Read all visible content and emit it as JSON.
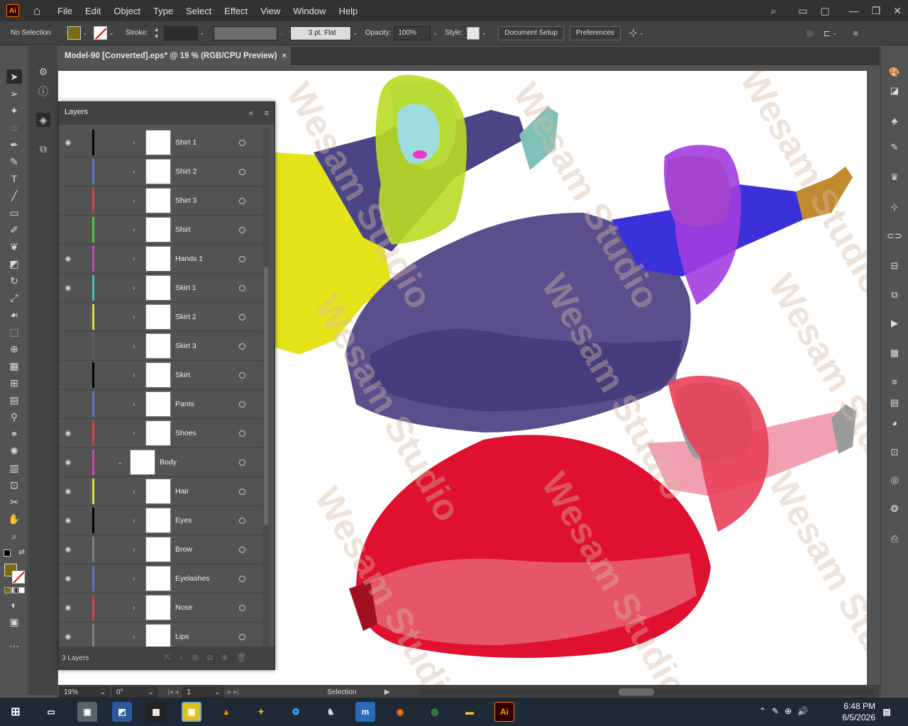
{
  "app": {
    "logo": "Ai",
    "menus": [
      "File",
      "Edit",
      "Object",
      "Type",
      "Select",
      "Effect",
      "View",
      "Window",
      "Help"
    ]
  },
  "control": {
    "selection": "No Selection",
    "stroke_label": "Stroke:",
    "brush": "3 pt. Flat",
    "opacity_label": "Opacity:",
    "opacity": "100%",
    "style_label": "Style:",
    "document_setup": "Document Setup",
    "preferences": "Preferences",
    "fill_color": "#7a6a10"
  },
  "document": {
    "tab_title": "Model-90 [Converted].eps* @ 19 % (RGB/CPU Preview)",
    "close": "×"
  },
  "layers": {
    "title": "Layers",
    "footer": "3 Layers",
    "rows": [
      {
        "name": "Shirt 1",
        "color": "#000000",
        "visible": true
      },
      {
        "name": "Shirt 2",
        "color": "#5a6fd0",
        "visible": false
      },
      {
        "name": "Shirt 3",
        "color": "#d04040",
        "visible": false
      },
      {
        "name": "Shirt",
        "color": "#40d040",
        "visible": false
      },
      {
        "name": "Hands 1",
        "color": "#d040c0",
        "visible": true
      },
      {
        "name": "Skirt 1",
        "color": "#40c0c0",
        "visible": true
      },
      {
        "name": "Skirt 2",
        "color": "#e0e040",
        "visible": false
      },
      {
        "name": "Skirt 3",
        "color": "#606060",
        "visible": false
      },
      {
        "name": "Skirt",
        "color": "#000000",
        "visible": false
      },
      {
        "name": "Pants",
        "color": "#5a6fd0",
        "visible": false
      },
      {
        "name": "Shoes",
        "color": "#d04040",
        "visible": true
      },
      {
        "name": "Body",
        "color": "#d040c0",
        "visible": true
      },
      {
        "name": "Hair",
        "color": "#e0e040",
        "visible": true
      },
      {
        "name": "Eyes",
        "color": "#000000",
        "visible": true
      },
      {
        "name": "Brow",
        "color": "#808080",
        "visible": true
      },
      {
        "name": "Eyelashes",
        "color": "#5a6fd0",
        "visible": true
      },
      {
        "name": "Nose",
        "color": "#d04040",
        "visible": true
      },
      {
        "name": "Lips",
        "color": "#808080",
        "visible": true
      }
    ]
  },
  "status": {
    "zoom": "19%",
    "rotation": "0°",
    "artboard": "1",
    "tool": "Selection"
  },
  "watermark": "Wesam Studio",
  "clock": {
    "time": "6:48 PM",
    "date": "6/5/2026"
  }
}
